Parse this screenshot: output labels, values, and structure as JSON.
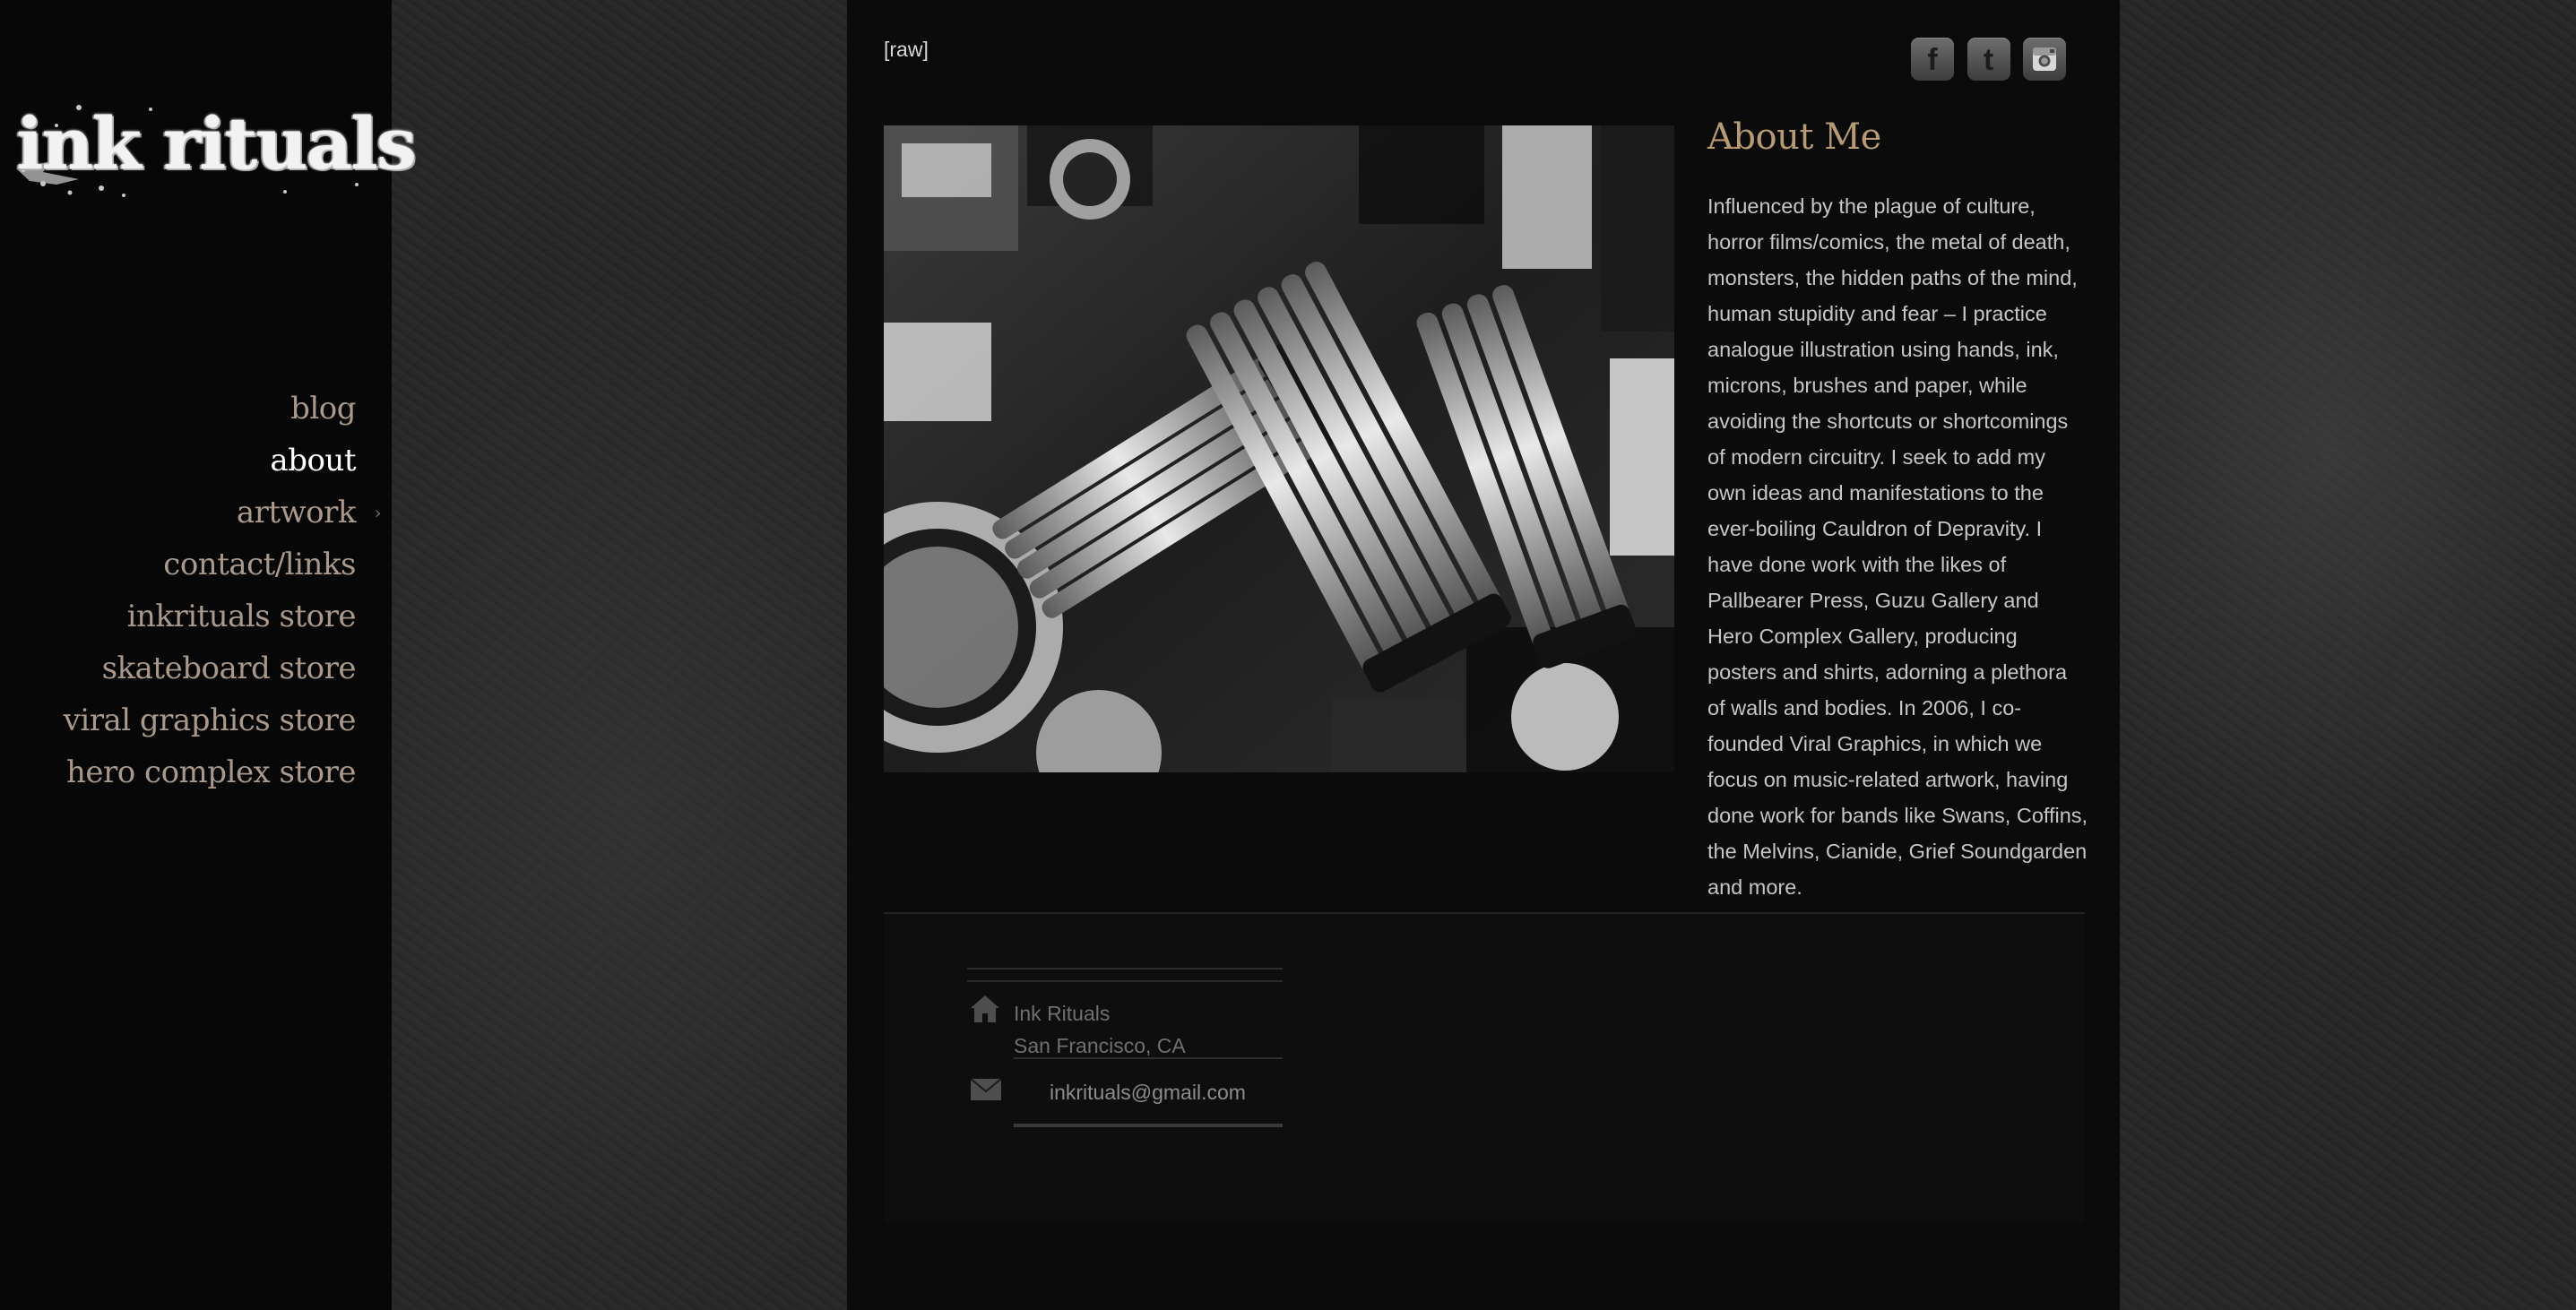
{
  "site": {
    "logo_text": "ink rituals"
  },
  "nav": {
    "items": [
      {
        "label": "blog",
        "active": false
      },
      {
        "label": "about",
        "active": true
      },
      {
        "label": "artwork",
        "active": false,
        "has_submenu": true
      },
      {
        "label": "contact/links",
        "active": false
      },
      {
        "label": "inkrituals store",
        "active": false
      },
      {
        "label": "skateboard store",
        "active": false
      },
      {
        "label": "viral graphics store",
        "active": false
      },
      {
        "label": "hero complex store",
        "active": false
      }
    ],
    "submenu_arrow": "›"
  },
  "header": {
    "raw_link": "[raw]",
    "social": [
      {
        "icon": "facebook-icon",
        "glyph": "f"
      },
      {
        "icon": "twitter-icon",
        "glyph": "t"
      },
      {
        "icon": "instagram-icon",
        "glyph": ""
      }
    ]
  },
  "about": {
    "title": "About Me",
    "body": "Influenced by the plague of culture, horror films/comics, the metal of death, monsters, the hidden paths of the mind, human stupidity and fear – I practice analogue illustration using hands, ink, microns, brushes and paper, while avoiding the shortcuts or shortcomings of modern circuitry. I seek to add my own ideas and manifestations to the ever-boiling Cauldron of Depravity. I have done work with the likes of Pallbearer Press, Guzu Gallery and Hero Complex Gallery, producing posters and shirts, adorning a plethora of walls and bodies. In 2006, I co-founded Viral Graphics, in which we focus on music-related artwork, having done work for bands like Swans, Coffins, the Melvins, Cianide, Grief Soundgarden and more."
  },
  "footer": {
    "name": "Ink Rituals",
    "city": "San Francisco, CA",
    "email": "inkrituals@gmail.com",
    "address_icon": "home-icon",
    "email_icon": "envelope-icon"
  },
  "colors": {
    "sidebar_bg": "#070707",
    "main_bg": "#0b0b0b",
    "nav_text": "#a8998a",
    "nav_active": "#ffffff",
    "heading": "#b59a72",
    "body_text": "#c6c6c6"
  }
}
